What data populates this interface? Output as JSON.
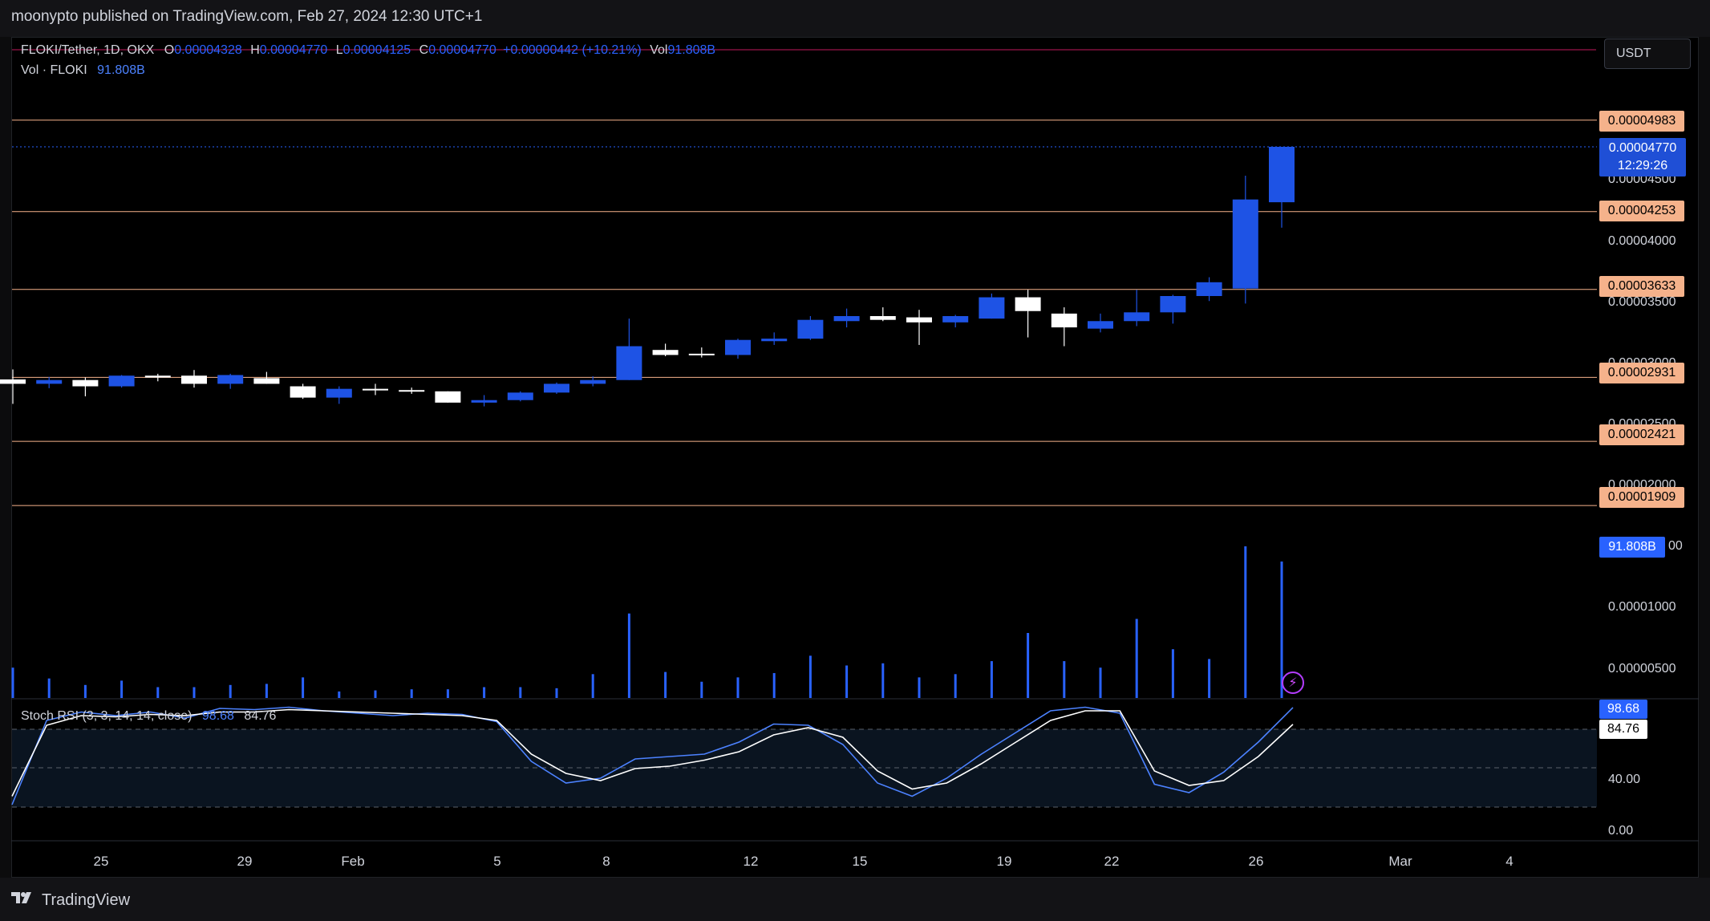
{
  "header": {
    "publish_text": "moonypto published on TradingView.com, Feb 27, 2024 12:30 UTC+1"
  },
  "legend": {
    "symbol": "FLOKI/Tether, 1D, OKX",
    "o_label": "O",
    "o_value": "0.00004328",
    "h_label": "H",
    "h_value": "0.00004770",
    "l_label": "L",
    "l_value": "0.00004125",
    "c_label": "C",
    "c_value": "0.00004770",
    "change": "+0.00000442 (+10.21%)",
    "vol_label": "Vol",
    "vol_value": "91.808B",
    "vol_row_label": "Vol · FLOKI",
    "vol_row_value": "91.808B"
  },
  "currency_button": "USDT",
  "price_axis": {
    "ticks": [
      "0.00004500",
      "0.00004000",
      "0.00003500",
      "0.00003000",
      "0.00002500",
      "0.00002000",
      "0.00001000",
      "0.00000500"
    ],
    "last_price": "0.00004770",
    "countdown": "12:29:26",
    "horizontal_levels": [
      "0.00004983",
      "0.00004253",
      "0.00003633",
      "0.00002931",
      "0.00002421",
      "0.00001909"
    ],
    "volume_label": "91.808B"
  },
  "stoch_rsi": {
    "title": "Stoch RSI (3, 3, 14, 14, close)",
    "k_value": "98.68",
    "d_value": "84.76",
    "ticks": [
      "40.00",
      "0.00"
    ]
  },
  "x_axis": [
    "25",
    "29",
    "Feb",
    "5",
    "8",
    "12",
    "15",
    "19",
    "22",
    "26",
    "Mar",
    "4"
  ],
  "footer": {
    "brand": "TradingView"
  },
  "colors": {
    "up": "#1e53e5",
    "down": "#ffffff",
    "level_line": "#f5b28b",
    "volume": "#2962ff",
    "rsi_k": "#4c82ff",
    "rsi_d": "#ffffff"
  },
  "chart_data": {
    "type": "candlestick",
    "symbol": "FLOKI/Tether",
    "candles": [
      {
        "o": 2.915e-05,
        "h": 2.995e-05,
        "l": 2.72e-05,
        "c": 2.88e-05
      },
      {
        "o": 2.88e-05,
        "h": 2.935e-05,
        "l": 2.845e-05,
        "c": 2.91e-05
      },
      {
        "o": 2.91e-05,
        "h": 2.93e-05,
        "l": 2.78e-05,
        "c": 2.86e-05
      },
      {
        "o": 2.86e-05,
        "h": 2.95e-05,
        "l": 2.85e-05,
        "c": 2.945e-05
      },
      {
        "o": 2.945e-05,
        "h": 2.96e-05,
        "l": 2.9e-05,
        "c": 2.93e-05
      },
      {
        "o": 2.945e-05,
        "h": 2.99e-05,
        "l": 2.85e-05,
        "c": 2.88e-05
      },
      {
        "o": 2.88e-05,
        "h": 2.96e-05,
        "l": 2.84e-05,
        "c": 2.95e-05
      },
      {
        "o": 2.925e-05,
        "h": 2.975e-05,
        "l": 2.88e-05,
        "c": 2.88e-05
      },
      {
        "o": 2.86e-05,
        "h": 2.88e-05,
        "l": 2.76e-05,
        "c": 2.77e-05
      },
      {
        "o": 2.77e-05,
        "h": 2.86e-05,
        "l": 2.72e-05,
        "c": 2.84e-05
      },
      {
        "o": 2.84e-05,
        "h": 2.88e-05,
        "l": 2.79e-05,
        "c": 2.83e-05
      },
      {
        "o": 2.83e-05,
        "h": 2.85e-05,
        "l": 2.8e-05,
        "c": 2.82e-05
      },
      {
        "o": 2.82e-05,
        "h": 2.82e-05,
        "l": 2.73e-05,
        "c": 2.73e-05
      },
      {
        "o": 2.73e-05,
        "h": 2.79e-05,
        "l": 2.7e-05,
        "c": 2.75e-05
      },
      {
        "o": 2.75e-05,
        "h": 2.82e-05,
        "l": 2.74e-05,
        "c": 2.81e-05
      },
      {
        "o": 2.81e-05,
        "h": 2.89e-05,
        "l": 2.8e-05,
        "c": 2.88e-05
      },
      {
        "o": 2.88e-05,
        "h": 2.94e-05,
        "l": 2.86e-05,
        "c": 2.91e-05
      },
      {
        "o": 2.91e-05,
        "h": 3.4e-05,
        "l": 2.91e-05,
        "c": 3.18e-05
      },
      {
        "o": 3.15e-05,
        "h": 3.2e-05,
        "l": 3.1e-05,
        "c": 3.11e-05
      },
      {
        "o": 3.12e-05,
        "h": 3.17e-05,
        "l": 3.09e-05,
        "c": 3.11e-05
      },
      {
        "o": 3.11e-05,
        "h": 3.24e-05,
        "l": 3.08e-05,
        "c": 3.23e-05
      },
      {
        "o": 3.22e-05,
        "h": 3.29e-05,
        "l": 3.19e-05,
        "c": 3.24e-05
      },
      {
        "o": 3.24e-05,
        "h": 3.42e-05,
        "l": 3.23e-05,
        "c": 3.39e-05
      },
      {
        "o": 3.38e-05,
        "h": 3.48e-05,
        "l": 3.33e-05,
        "c": 3.42e-05
      },
      {
        "o": 3.42e-05,
        "h": 3.49e-05,
        "l": 3.38e-05,
        "c": 3.39e-05
      },
      {
        "o": 3.41e-05,
        "h": 3.47e-05,
        "l": 3.19e-05,
        "c": 3.37e-05
      },
      {
        "o": 3.37e-05,
        "h": 3.43e-05,
        "l": 3.33e-05,
        "c": 3.42e-05
      },
      {
        "o": 3.4e-05,
        "h": 3.6e-05,
        "l": 3.4e-05,
        "c": 3.57e-05
      },
      {
        "o": 3.57e-05,
        "h": 3.63e-05,
        "l": 3.25e-05,
        "c": 3.46e-05
      },
      {
        "o": 3.44e-05,
        "h": 3.49e-05,
        "l": 3.18e-05,
        "c": 3.33e-05
      },
      {
        "o": 3.32e-05,
        "h": 3.44e-05,
        "l": 3.29e-05,
        "c": 3.38e-05
      },
      {
        "o": 3.38e-05,
        "h": 3.63e-05,
        "l": 3.34e-05,
        "c": 3.45e-05
      },
      {
        "o": 3.45e-05,
        "h": 3.59e-05,
        "l": 3.36e-05,
        "c": 3.58e-05
      },
      {
        "o": 3.58e-05,
        "h": 3.73e-05,
        "l": 3.54e-05,
        "c": 3.69e-05
      },
      {
        "o": 3.64e-05,
        "h": 4.54e-05,
        "l": 3.52e-05,
        "c": 4.35e-05
      },
      {
        "o": 4.328e-05,
        "h": 4.77e-05,
        "l": 4.125e-05,
        "c": 4.77e-05
      }
    ],
    "volume_scale_note": "volume pane",
    "volume": [
      28,
      18,
      12,
      16,
      10,
      10,
      12,
      13,
      19,
      6,
      7,
      8,
      8,
      10,
      10,
      9,
      22,
      78,
      24,
      15,
      19,
      23,
      39,
      30,
      32,
      19,
      22,
      34,
      60,
      34,
      28,
      73,
      45,
      36,
      140,
      126
    ],
    "stoch_k": [
      18,
      88,
      95,
      92,
      95,
      90,
      98,
      97,
      99,
      96,
      94,
      92,
      94,
      93,
      87,
      54,
      36,
      40,
      56,
      58,
      60,
      70,
      85,
      84,
      68,
      36,
      25,
      40,
      60,
      78,
      96,
      99,
      94,
      35,
      28,
      45,
      70,
      98.68
    ],
    "stoch_d": [
      25,
      84,
      92,
      91,
      93,
      92,
      95,
      95,
      97,
      96,
      95,
      94,
      93,
      92,
      88,
      60,
      44,
      38,
      48,
      50,
      55,
      62,
      76,
      82,
      74,
      46,
      31,
      36,
      52,
      70,
      88,
      96,
      96,
      46,
      34,
      38,
      58,
      84.76
    ],
    "y_range": [
      1e-05,
      5.4e-05
    ],
    "levels": [
      4.983e-05,
      4.253e-05,
      3.633e-05,
      2.931e-05,
      2.421e-05,
      1.909e-05
    ]
  }
}
